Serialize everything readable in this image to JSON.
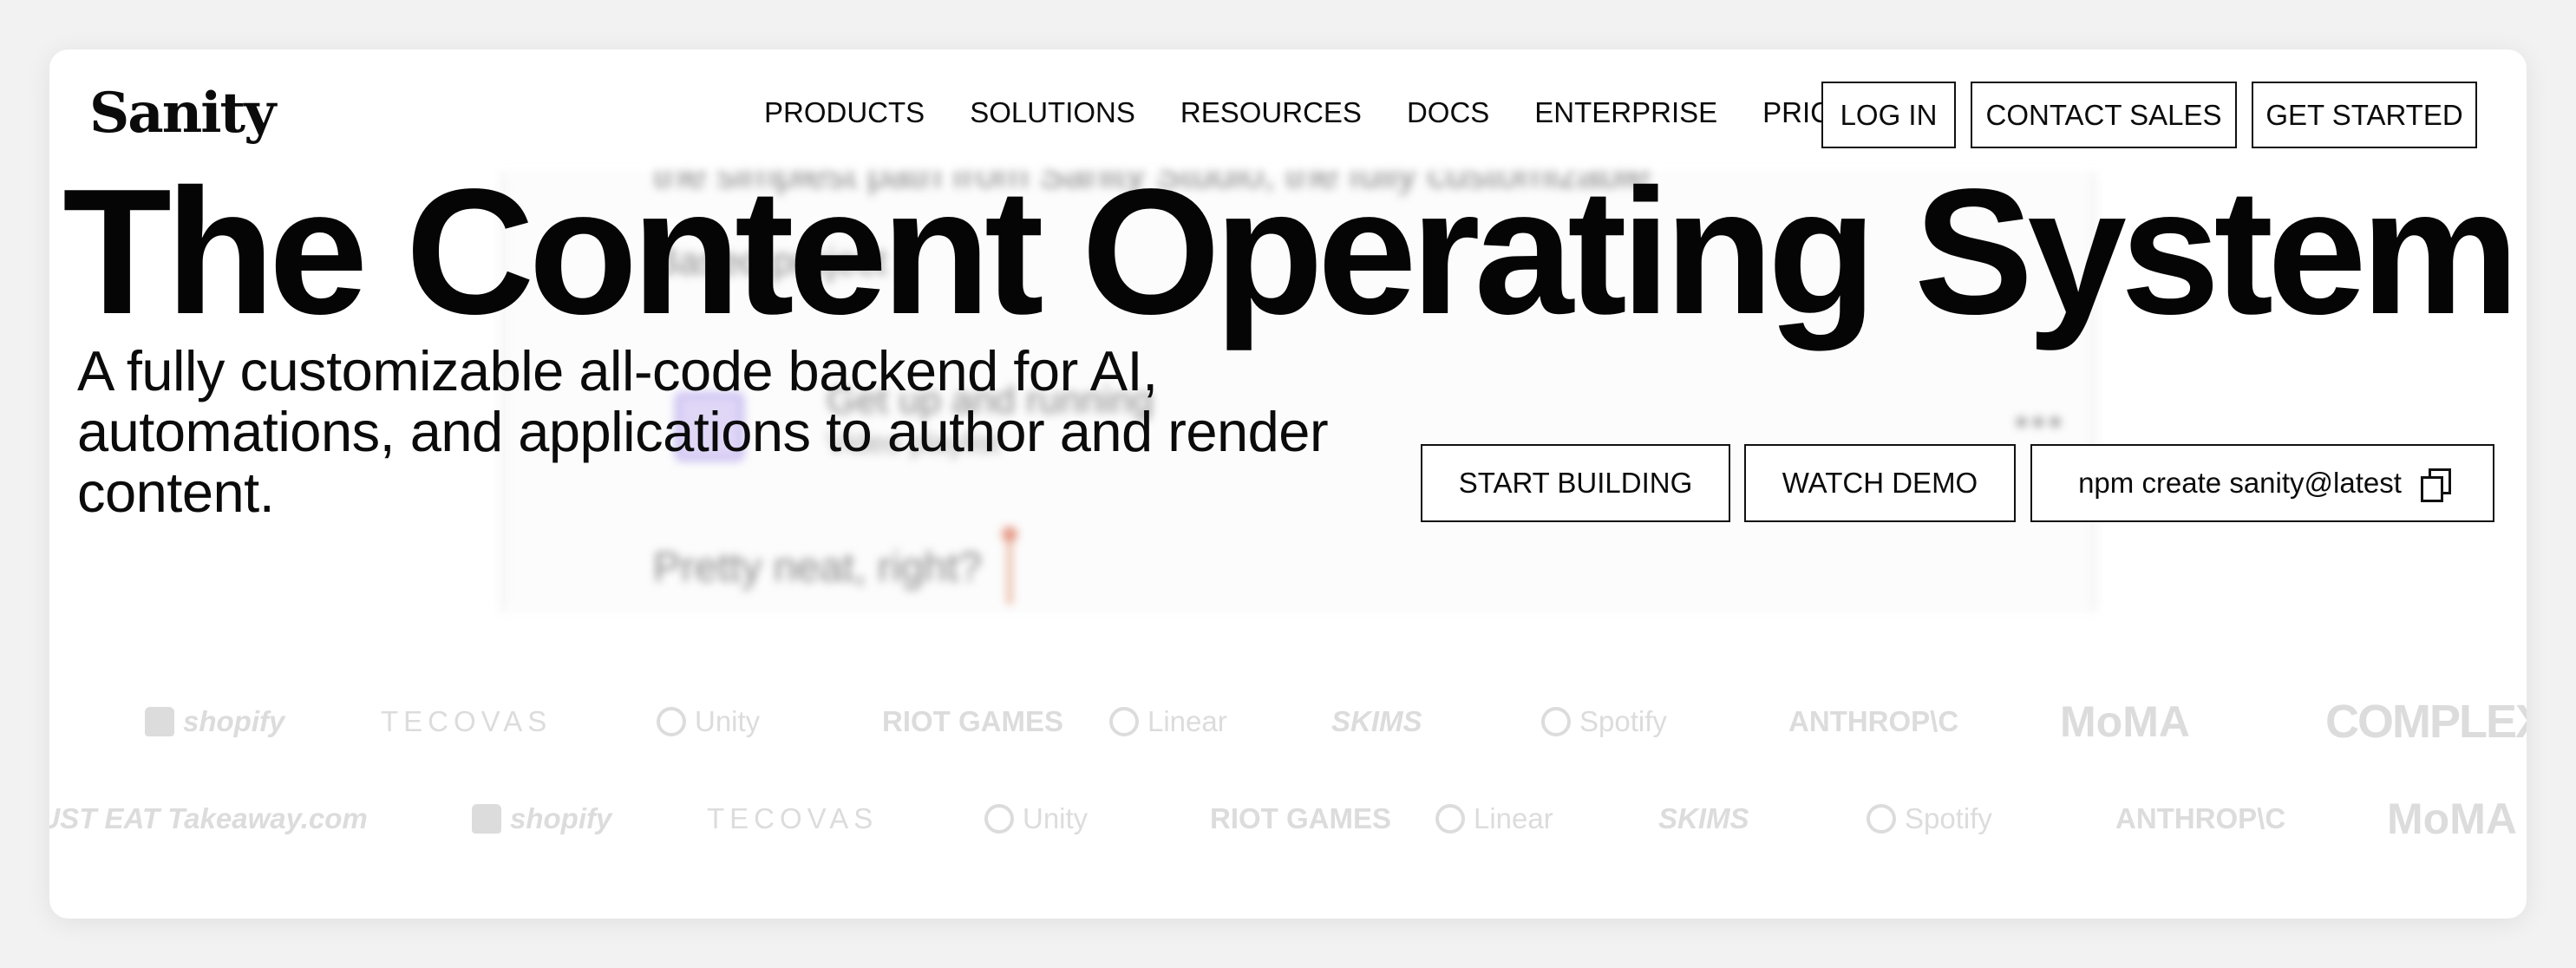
{
  "header": {
    "logo": "Sanity",
    "nav": [
      "PRODUCTS",
      "SOLUTIONS",
      "RESOURCES",
      "DOCS",
      "ENTERPRISE",
      "PRICING"
    ],
    "login": "LOG IN",
    "contact": "CONTACT SALES",
    "get_started": "GET STARTED"
  },
  "hero": {
    "title": "The Content Operating System",
    "subtitle": "A fully customizable all-code backend for AI, automations, and applications to author and render content.",
    "start_building": "START BUILDING",
    "watch_demo": "WATCH DEMO",
    "npm_command": "npm create sanity@latest"
  },
  "background_preview": {
    "line1": "the simplest path from Sanity Studio, the fully customizable",
    "line2": "Based project",
    "item_title": "Get up and running",
    "item_subtitle": "Video playlist",
    "dots": "•••",
    "typing": "Pretty neat, right?"
  },
  "logos": {
    "row1": [
      "shopify",
      "TECOVAS",
      "Unity",
      "RIOT GAMES",
      "Linear",
      "SKIMS",
      "Spotify",
      "ANTHROP\\C",
      "MoMA",
      "COMPLEX"
    ],
    "row2": [
      "JUST EAT Takeaway.com",
      "shopify",
      "TECOVAS",
      "Unity",
      "RIOT GAMES",
      "Linear",
      "SKIMS",
      "Spotify",
      "ANTHROP\\C",
      "MoMA"
    ]
  },
  "colors": {
    "page_bg": "#f2f2f2",
    "card_bg": "#ffffff",
    "text": "#0b0b0b",
    "logo_gray": "#dcdcdc"
  }
}
